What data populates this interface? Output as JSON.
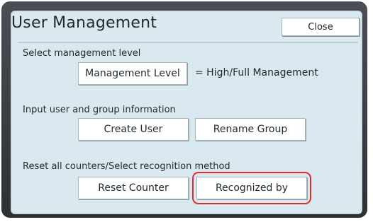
{
  "window": {
    "title": "User Management",
    "close_label": "Close"
  },
  "management": {
    "section_label": "Select management level",
    "level_button": "Management Level",
    "level_value": "= High/Full Management"
  },
  "user_group": {
    "section_label": "Input user and group information",
    "create_user_button": "Create User",
    "rename_group_button": "Rename Group"
  },
  "counters": {
    "section_label": "Reset all counters/Select recognition method",
    "reset_counter_button": "Reset Counter",
    "recognized_by_button": "Recognized by"
  },
  "colors": {
    "panel_background": "#d9e9ef",
    "highlight": "#e02c2c"
  }
}
